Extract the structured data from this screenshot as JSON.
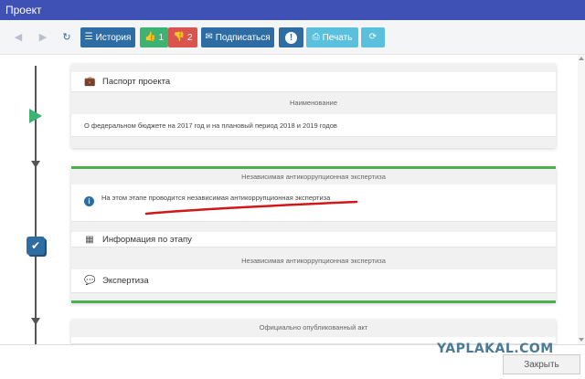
{
  "window": {
    "title": "Проект"
  },
  "toolbar": {
    "history_label": "История",
    "likes_count": "1",
    "dislikes_count": "2",
    "subscribe_label": "Подписаться",
    "alert_label": "!",
    "print_label": "Печать"
  },
  "passport_card": {
    "header": "Паспорт проекта",
    "name_label": "Наименование",
    "name_value": "О федеральном бюджете на 2017 год и на плановый период 2018 и 2019 годов"
  },
  "stage_card": {
    "stage_title": "Независимая антикоррупционная экспертиза",
    "status_text": "На этом этапе проводится независимая антикоррупционная экспертиза",
    "info_label": "Информация по этапу",
    "sub_title": "Независимая антикоррупционная экспертиза",
    "expertise_label": "Экспертиза"
  },
  "act_card": {
    "title": "Официально опубликованный акт"
  },
  "footer": {
    "close_label": "Закрыть"
  },
  "watermark": "YAPLAKAL.COM",
  "colors": {
    "titlebar": "#3f51b5",
    "button_blue": "#2e6da4",
    "button_green": "#3cb371",
    "button_red": "#d9534f",
    "button_cyan": "#5bc0de",
    "accent_line": "#4caf50",
    "annotation": "#d01818"
  }
}
